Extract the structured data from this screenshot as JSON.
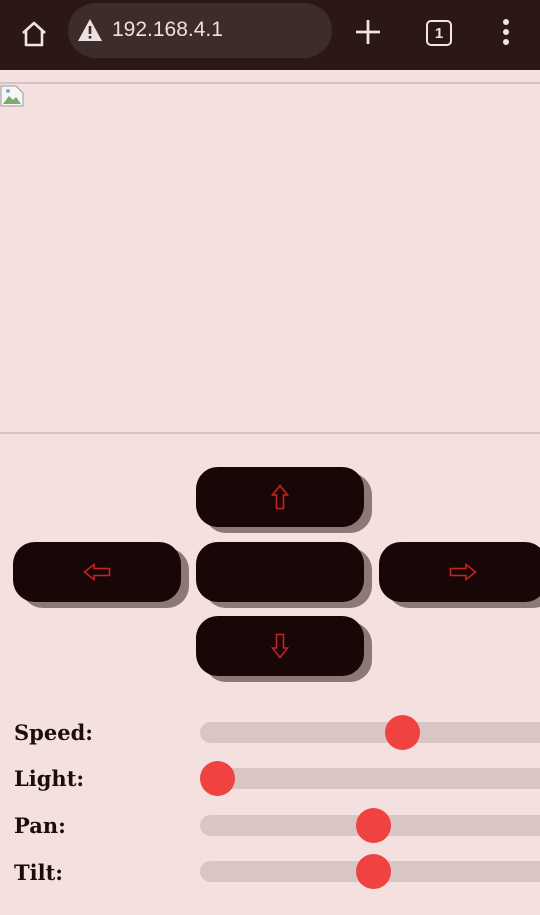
{
  "browser": {
    "url": "192.168.4.1",
    "tab_count": "1",
    "icons": {
      "home": "home-icon",
      "warning": "warning-triangle-icon",
      "new_tab": "plus-icon",
      "tabs": "tab-switcher-icon",
      "menu": "vertical-dots-icon"
    }
  },
  "stream": {
    "image_state": "broken-image-icon"
  },
  "controls": {
    "up": "⇧",
    "down": "⇩",
    "left": "⇦",
    "right": "⇨",
    "center": ""
  },
  "sliders": [
    {
      "label": "Speed:",
      "value": 0.595
    },
    {
      "label": "Light:",
      "value": 0.05
    },
    {
      "label": "Pan:",
      "value": 0.51
    },
    {
      "label": "Tilt:",
      "value": 0.51
    }
  ],
  "colors": {
    "page_bg": "#f4e0df",
    "button_bg": "#180706",
    "arrow": "#c52222",
    "thumb": "#f04241",
    "track": "#d9c5c4"
  }
}
